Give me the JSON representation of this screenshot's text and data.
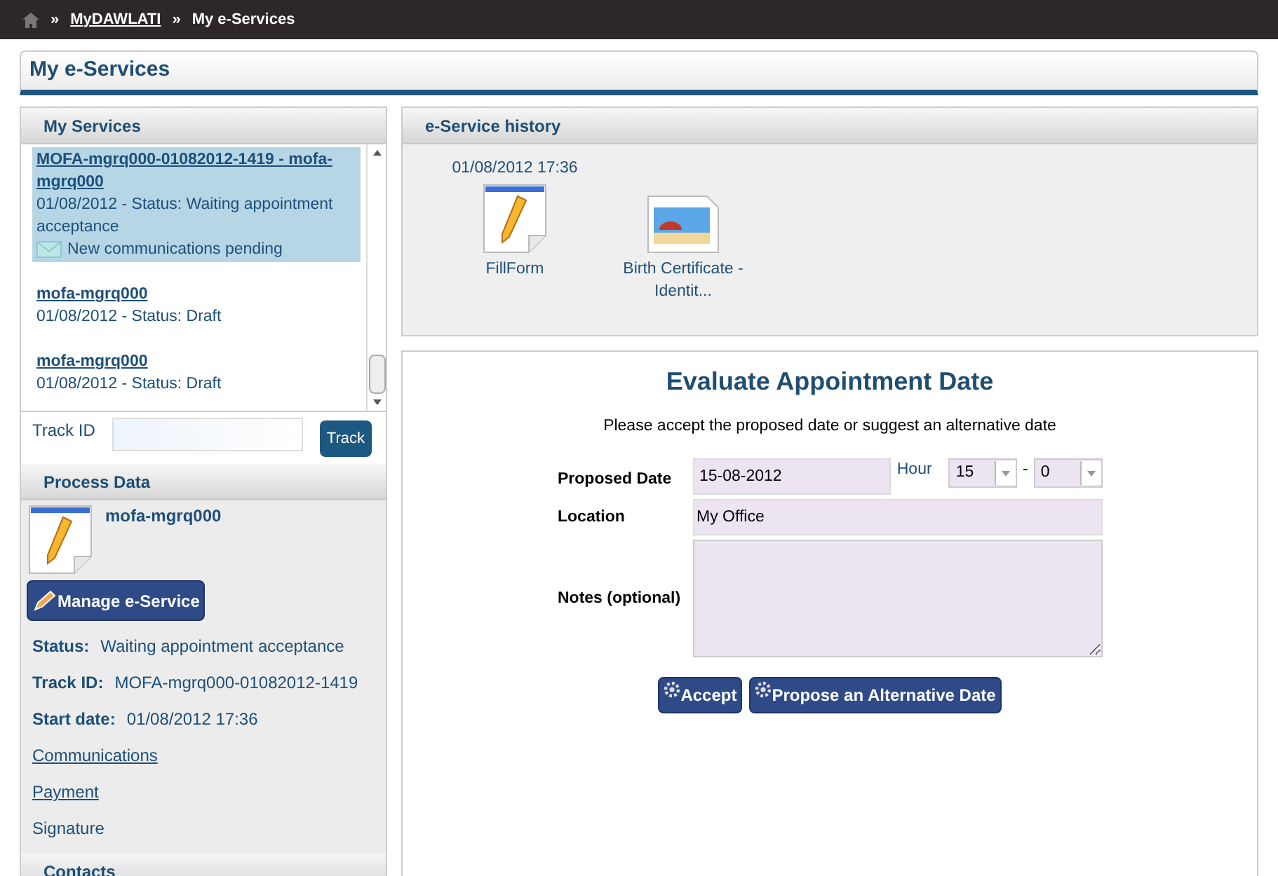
{
  "breadcrumb": {
    "items": [
      {
        "label": "MyDAWLATI",
        "link": true
      },
      {
        "label": "My e-Services",
        "link": false
      }
    ],
    "separator": "»"
  },
  "page_title": "My e-Services",
  "my_services": {
    "title": "My Services",
    "items": [
      {
        "title": "MOFA-mgrq000-01082012-1419 - mofa-mgrq000",
        "status": "01/08/2012 - Status: Waiting appointment acceptance",
        "notice": "New communications pending",
        "selected": true
      },
      {
        "title": "mofa-mgrq000",
        "status": "01/08/2012 - Status: Draft",
        "selected": false
      },
      {
        "title": "mofa-mgrq000",
        "status": "01/08/2012 - Status: Draft",
        "selected": false
      }
    ],
    "track_label": "Track ID",
    "track_button": "Track"
  },
  "process_data": {
    "title": "Process Data",
    "name": "mofa-mgrq000",
    "manage_button": "Manage e-Service",
    "fields": [
      {
        "label": "Status:",
        "value": "Waiting appointment acceptance"
      },
      {
        "label": "Track ID:",
        "value": "MOFA-mgrq000-01082012-1419"
      },
      {
        "label": "Start date:",
        "value": "01/08/2012 17:36"
      }
    ],
    "links": [
      {
        "label": "Communications",
        "link": true
      },
      {
        "label": "Payment",
        "link": true
      },
      {
        "label": "Signature",
        "link": false
      }
    ]
  },
  "contacts": {
    "title": "Contacts"
  },
  "history": {
    "title": "e-Service history",
    "date": "01/08/2012 17:36",
    "items": [
      {
        "kind": "form",
        "label": "FillForm"
      },
      {
        "kind": "image",
        "label": "Birth Certificate - Identit..."
      }
    ]
  },
  "form": {
    "title": "Evaluate Appointment Date",
    "instruction": "Please accept the proposed date or suggest an alternative date",
    "proposed_date_label": "Proposed Date",
    "proposed_date": "15-08-2012",
    "hour_label": "Hour",
    "hour": "15",
    "separator": "-",
    "minute": "0",
    "location_label": "Location",
    "location": "My Office",
    "notes_label": "Notes (optional)",
    "buttons": [
      "Accept",
      "Propose an Alternative Date"
    ]
  }
}
